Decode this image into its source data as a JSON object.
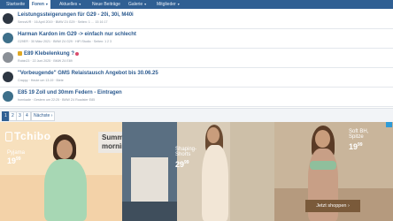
{
  "nav": {
    "items": [
      {
        "label": "Startseite",
        "caret": ""
      },
      {
        "label": "Foren",
        "caret": "▾"
      },
      {
        "label": "Aktuelles",
        "caret": "▾"
      },
      {
        "label": "Neue Beiträge",
        "caret": ""
      },
      {
        "label": "Galerie",
        "caret": "▾"
      },
      {
        "label": "Mitglieder",
        "caret": "▾"
      }
    ]
  },
  "threads": [
    {
      "title": "Leistungssteigerungen für G29 - 20i, 30i, M40i",
      "meta": "SennaVR · 16 April 2019 · BMW Z4 G29 · Seiten: 1 … 15 16 17"
    },
    {
      "title": "Harman Kardon im G29 -> einfach nur schlecht",
      "meta": "G29ER · 30 März 2021 · BMW Z4 G29 · HiFi Studio · Seiten: 1 2 3"
    },
    {
      "title": "E89 Klebelenkung ?",
      "meta": "Robin23 · 22 Juni 2025 · BMW Z4 E89"
    },
    {
      "title": "\"Vorbeugende\" GMS Relaistausch Angebot bis 30.06.25",
      "meta": "Crappy · Heute um 13:19 · Biete"
    },
    {
      "title": "E85 19 Zoll und 30mm Federn - Eintragen",
      "meta": "hornkade · Gestern um 22:25 · BMW Z4 Roadster E85"
    }
  ],
  "pager": {
    "pages": [
      "1",
      "2",
      "3",
      "4"
    ],
    "next": "Nächste ›"
  },
  "ad": {
    "brand": "Tchibo",
    "p1_label": "Pyjama",
    "p1_price": "19",
    "p1_cents": "99",
    "box_line1": "Summer",
    "box_line2": "mornings",
    "p3_label1": "Shaping-",
    "p3_label2": "Shorts",
    "p3_price": "29",
    "p3_cents": "99",
    "p4_label1": "Soft BH,",
    "p4_label2": "Spitze",
    "p4_price": "19",
    "p4_cents": "99",
    "cta": "Jetzt shoppen ›"
  }
}
